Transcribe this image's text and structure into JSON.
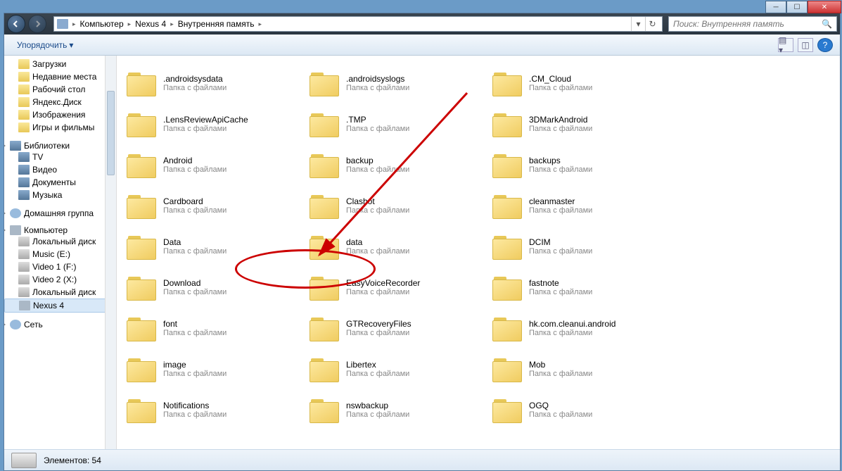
{
  "breadcrumbs": [
    "Компьютер",
    "Nexus 4",
    "Внутренняя память"
  ],
  "search": {
    "placeholder": "Поиск: Внутренняя память"
  },
  "toolbar": {
    "organize": "Упорядочить"
  },
  "sidebar": {
    "favorites": [
      "Загрузки",
      "Недавние места",
      "Рабочий стол",
      "Яндекс.Диск",
      "Изображения",
      "Игры и фильмы"
    ],
    "libraries_label": "Библиотеки",
    "libraries": [
      "TV",
      "Видео",
      "Документы",
      "Музыка"
    ],
    "homegroup": "Домашняя группа",
    "computer_label": "Компьютер",
    "drives": [
      "Локальный диск",
      "Music (E:)",
      "Video 1 (F:)",
      "Video 2 (X:)",
      "Локальный диск",
      "Nexus 4"
    ],
    "network": "Сеть"
  },
  "folder_subtitle": "Папка с файлами",
  "folders": [
    ".androidsysdata",
    ".androidsyslogs",
    ".CM_Cloud",
    ".LensReviewApiCache",
    ".TMP",
    "3DMarkAndroid",
    "Android",
    "backup",
    "backups",
    "Cardboard",
    "Clashot",
    "cleanmaster",
    "Data",
    "data",
    "DCIM",
    "Download",
    "EasyVoiceRecorder",
    "fastnote",
    "font",
    "GTRecoveryFiles",
    "hk.com.cleanui.android",
    "image",
    "Libertex",
    "Mob",
    "Notifications",
    "nswbackup",
    "OGQ"
  ],
  "status": {
    "count_label": "Элементов:",
    "count": "54"
  }
}
